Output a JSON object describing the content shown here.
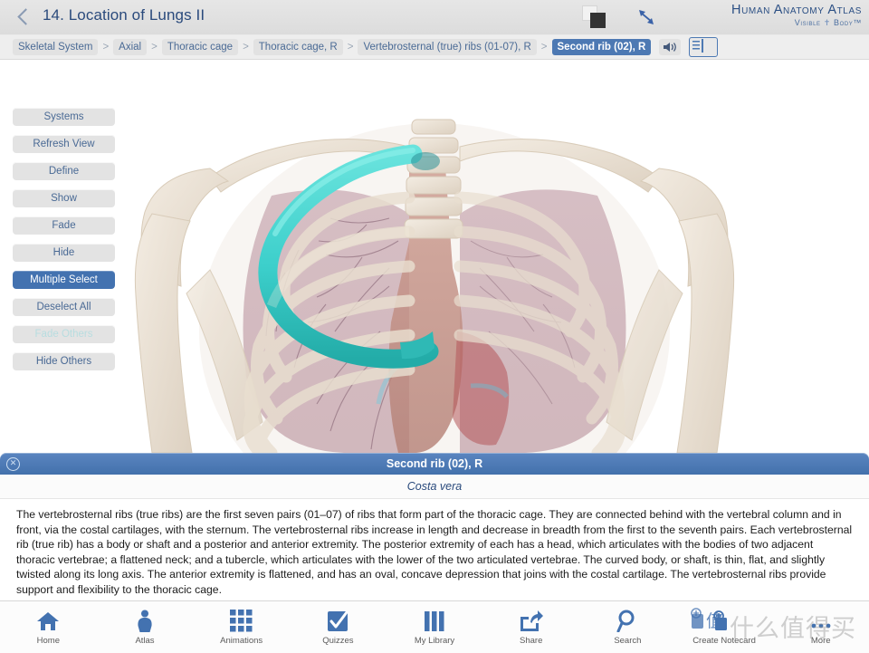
{
  "header": {
    "back_icon": "chevron-left-icon",
    "lesson_title": "14. Location of Lungs II",
    "layers_icon": "layered-squares-icon",
    "resize_icon": "diagonal-resize-arrows-icon",
    "brand_line1": "Human Anatomy Atlas",
    "brand_line2_a": "Visible",
    "brand_line2_b": "Body",
    "brand_tm": "™"
  },
  "breadcrumb": {
    "items": [
      {
        "label": "Skeletal System",
        "active": false
      },
      {
        "label": "Axial",
        "active": false
      },
      {
        "label": "Thoracic cage",
        "active": false
      },
      {
        "label": "Thoracic cage, R",
        "active": false
      },
      {
        "label": "Vertebrosternal (true) ribs (01-07), R",
        "active": false
      },
      {
        "label": "Second rib (02), R",
        "active": true
      }
    ],
    "separator": ">",
    "speaker_icon": "speaker-audio-icon",
    "book_icon": "book-open-icon"
  },
  "tools": [
    {
      "label": "Systems",
      "state": "normal"
    },
    {
      "label": "Refresh View",
      "state": "normal"
    },
    {
      "label": "Define",
      "state": "normal"
    },
    {
      "label": "Show",
      "state": "normal"
    },
    {
      "label": "Fade",
      "state": "normal"
    },
    {
      "label": "Hide",
      "state": "normal"
    },
    {
      "label": "Multiple Select",
      "state": "primary"
    },
    {
      "label": "Deselect All",
      "state": "normal"
    },
    {
      "label": "Fade Others",
      "state": "disabled"
    },
    {
      "label": "Hide Others",
      "state": "normal"
    }
  ],
  "viewport": {
    "description": "3D anterior view of human thoracic cage with translucent lungs, vasculature and shoulder girdle",
    "highlight_label": "Second rib (02), R",
    "highlight_color": "#3fd0cc",
    "bone_color": "#eee4d8",
    "lung_color": "#c8a8b0",
    "background": "#ffffff"
  },
  "info_panel": {
    "close_icon": "close-circle-icon",
    "title": "Second rib (02), R",
    "subtitle": "Costa vera",
    "body": "The vertebrosternal ribs (true ribs) are the first seven pairs (01–07) of ribs that form part of the thoracic cage. They are connected behind with the vertebral column and in front, via the costal cartilages, with the sternum. The vertebrosternal ribs increase in length and decrease in breadth from the first to the seventh pairs. Each vertebrosternal rib (true rib) has a body or shaft and a posterior and anterior extremity. The posterior extremity of each has a head, which articulates with the bodies of two adjacent thoracic vertebrae; a flattened neck; and a tubercle, which articulates with the lower of the two articulated vertebrae. The curved body, or shaft, is thin, flat, and slightly twisted along its long axis. The anterior extremity is flattened, and has an oval, concave depression that joins with the costal cartilage. The vertebrosternal ribs provide support and flexibility to the thoracic cage."
  },
  "tabbar": [
    {
      "label": "Home",
      "icon": "home-icon"
    },
    {
      "label": "Atlas",
      "icon": "person-body-icon"
    },
    {
      "label": "Animations",
      "icon": "grid-squares-icon"
    },
    {
      "label": "Quizzes",
      "icon": "checkmark-box-icon"
    },
    {
      "label": "My Library",
      "icon": "books-shelf-icon"
    },
    {
      "label": "Share",
      "icon": "share-arrow-icon"
    },
    {
      "label": "Search",
      "icon": "magnifier-icon"
    },
    {
      "label": "Create Notecard",
      "icon": "notecard-plus-icon"
    },
    {
      "label": "More",
      "icon": "more-icon"
    }
  ],
  "watermark": {
    "text": "什么值得买"
  },
  "colors": {
    "accent_blue": "#4372b0",
    "crumb_text": "#4a6a95",
    "title_blue": "#2a4a7c",
    "highlight_cyan": "#3fd0cc",
    "disabled_text": "#b8dde0"
  }
}
